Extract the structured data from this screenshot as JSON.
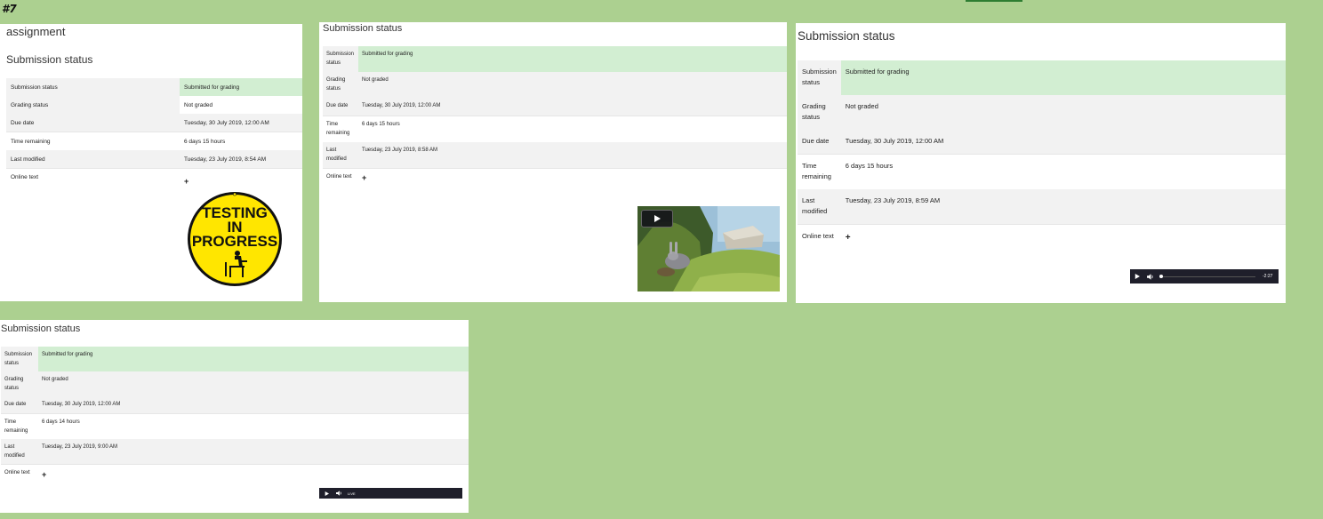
{
  "page_label": "#7",
  "colors": {
    "background": "#acd090",
    "submitted_row": "#d2eed2",
    "alt_row": "#f2f2f2",
    "player": "#1f1f2b"
  },
  "panel1": {
    "heading": "assignment",
    "title": "Submission status",
    "rows": [
      {
        "label": "Submission status",
        "value": "Submitted for grading"
      },
      {
        "label": "Grading status",
        "value": "Not graded"
      },
      {
        "label": "Due date",
        "value": "Tuesday, 30 July 2019, 12:00 AM"
      },
      {
        "label": "Time remaining",
        "value": "6 days 15 hours"
      },
      {
        "label": "Last modified",
        "value": "Tuesday, 23 July 2019, 8:54 AM"
      }
    ],
    "online_text_label": "Online text",
    "expand_icon": "+",
    "badge": {
      "line1": "TESTING",
      "line2": "IN",
      "line3": "PROGRESS"
    }
  },
  "panel2": {
    "title": "Submission status",
    "rows": [
      {
        "label": "Submission status",
        "value": "Submitted for grading"
      },
      {
        "label": "Grading status",
        "value": "Not graded"
      },
      {
        "label": "Due date",
        "value": "Tuesday, 30 July 2019, 12:00 AM"
      },
      {
        "label": "Time remaining",
        "value": "6 days 15 hours"
      },
      {
        "label": "Last modified",
        "value": "Tuesday, 23 July 2019, 8:58 AM"
      }
    ],
    "online_text_label": "Online text",
    "expand_icon": "+",
    "video_icon": "play-icon"
  },
  "panel3": {
    "title": "Submission status",
    "rows": [
      {
        "label": "Submission status",
        "value": "Submitted for grading"
      },
      {
        "label": "Grading status",
        "value": "Not graded"
      },
      {
        "label": "Due date",
        "value": "Tuesday, 30 July 2019, 12:00 AM"
      },
      {
        "label": "Time remaining",
        "value": "6 days 15 hours"
      },
      {
        "label": "Last modified",
        "value": "Tuesday, 23 July 2019, 8:59 AM"
      }
    ],
    "online_text_label": "Online text",
    "expand_icon": "+",
    "audio": {
      "time": "-2:27",
      "progress": 0
    }
  },
  "panel4": {
    "title": "Submission status",
    "rows": [
      {
        "label": "Submission status",
        "value": "Submitted for grading"
      },
      {
        "label": "Grading status",
        "value": "Not graded"
      },
      {
        "label": "Due date",
        "value": "Tuesday, 30 July 2019, 12:00 AM"
      },
      {
        "label": "Time remaining",
        "value": "6 days 14 hours"
      },
      {
        "label": "Last modified",
        "value": "Tuesday, 23 July 2019, 9:00 AM"
      }
    ],
    "online_text_label": "Online text",
    "expand_icon": "+",
    "audio": {
      "live": "LIVE"
    }
  }
}
